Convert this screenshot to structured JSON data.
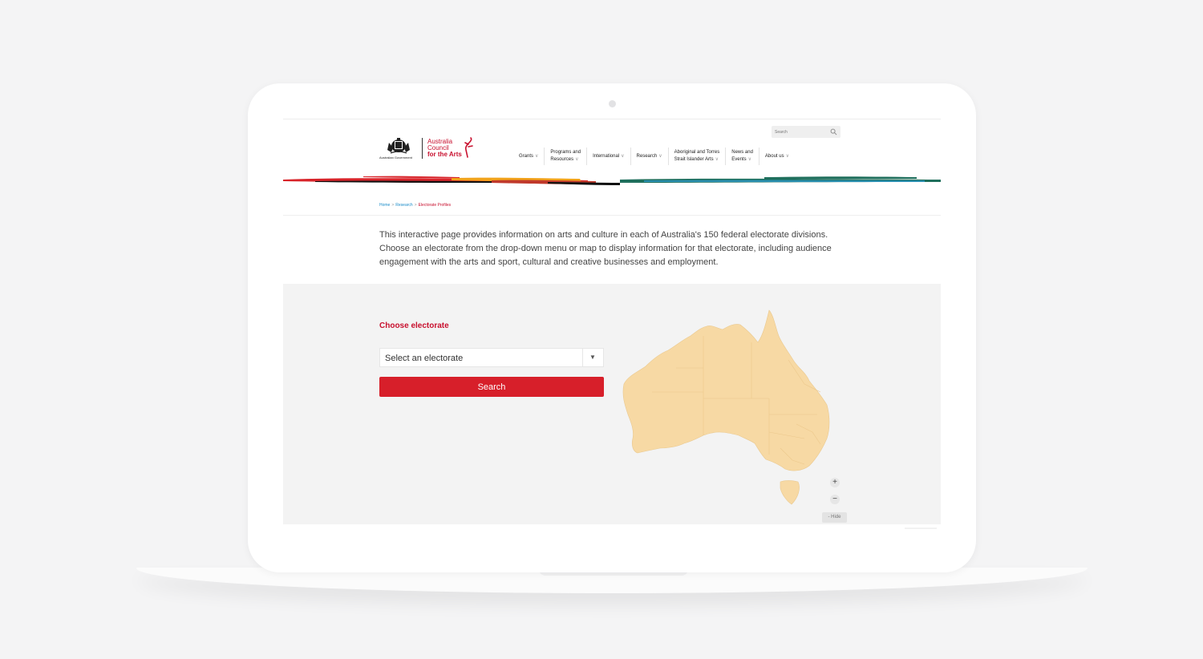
{
  "header": {
    "logo": {
      "government": "Australian Government",
      "line1": "Australia",
      "line2": "Council",
      "line3": "for the Arts"
    },
    "search": {
      "placeholder": "Search",
      "icon": "search-icon"
    },
    "nav": [
      {
        "line1": "Grants",
        "line2": ""
      },
      {
        "line1": "Programs and",
        "line2": "Resources"
      },
      {
        "line1": "International",
        "line2": ""
      },
      {
        "line1": "Research",
        "line2": ""
      },
      {
        "line1": "Aboriginal and Torres",
        "line2": "Strait Islander Arts"
      },
      {
        "line1": "News and",
        "line2": "Events"
      },
      {
        "line1": "About us",
        "line2": ""
      }
    ]
  },
  "breadcrumb": {
    "home": "Home",
    "research": "Research",
    "current": "Electorate Profiles",
    "separator": ">"
  },
  "intro": "This interactive page provides information on arts and culture in each of Australia's 150 federal electorate divisions. Choose an electorate from the drop-down menu or map to display information for that electorate, including audience engagement with the arts and sport, cultural and creative businesses and employment.",
  "form": {
    "heading": "Choose electorate",
    "select_value": "Select an electorate",
    "search_label": "Search"
  },
  "map_controls": {
    "zoom_in": "+",
    "zoom_out": "−",
    "hide": "- Hide"
  },
  "colors": {
    "accent": "#d71f2a",
    "link": "#1a8cc9",
    "map_fill": "#f7d9a4"
  }
}
